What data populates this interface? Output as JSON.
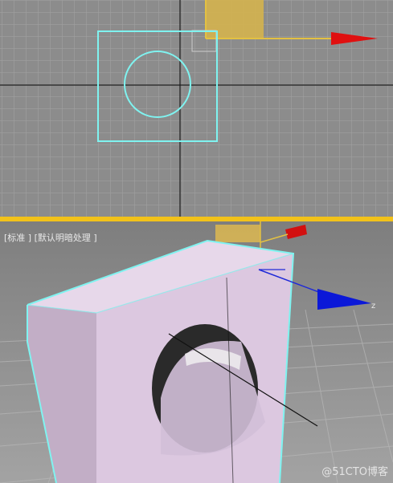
{
  "top_viewport": {
    "axis_x_label": "",
    "axis_y_label": ""
  },
  "bottom_viewport": {
    "label_mode": "[标准 ]",
    "label_shading": "[默认明暗处理 ]",
    "gizmo_z_label": "z"
  },
  "watermark": "@51CTO博客",
  "colors": {
    "grid_bg": "#8c8c8c",
    "grid_line": "#a5a5a5",
    "axis_line": "#1a1a1a",
    "selection": "#7ff3f0",
    "object_face": "#e2cfe6",
    "gizmo_x": "#e01010",
    "gizmo_z": "#0b18d8",
    "gizmo_plane": "#e8c552",
    "divider": "#f2c21a"
  }
}
